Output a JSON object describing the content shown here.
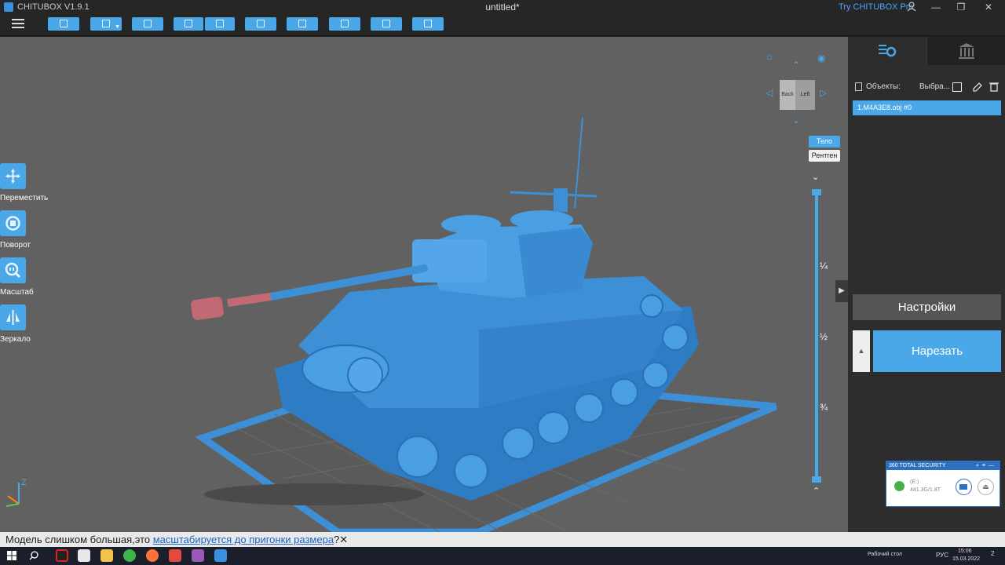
{
  "titlebar": {
    "app_title": "CHITUBOX V1.9.1",
    "document_title": "untitled*",
    "promo_link": "Try CHITUBOX Pro",
    "minimize": "—",
    "maximize": "❐",
    "close": "✕"
  },
  "toolbar": {
    "buttons": [
      "open-file",
      "save",
      "screenshot",
      "import",
      "export",
      "project",
      "support",
      "hollow",
      "pixel",
      "package"
    ]
  },
  "tools": [
    {
      "label": "Переместить",
      "icon": "move-icon"
    },
    {
      "label": "Поворот",
      "icon": "rotate-icon"
    },
    {
      "label": "Масштаб",
      "icon": "scale-icon"
    },
    {
      "label": "Зеркало",
      "icon": "mirror-icon"
    }
  ],
  "navcube": {
    "face_back": "Back",
    "face_left": "Left"
  },
  "view_modes": {
    "body": "Тело",
    "xray": "Рентген"
  },
  "slider": {
    "top_chevron": "⌄",
    "bottom_chevron": "⌃",
    "marks": [
      "¼",
      "½",
      "¾"
    ]
  },
  "panel": {
    "objects_label": "Объекты:",
    "select_label": "Выбра...",
    "object_row": "1.M4A3E8.obj #0",
    "settings_button": "Настройки",
    "slice_button": "Нарезать",
    "collapse_glyph": "▶",
    "up_glyph": "▲"
  },
  "security_popup": {
    "title": "360 TOTAL SECURITY",
    "drive_name": "(E:)",
    "drive_usage": "441.3G/1.8T",
    "eject_glyph": "⏏"
  },
  "status": {
    "message_prefix": "Модель слишком большая,это ",
    "link_text": "масштабируется до пригонки размера",
    "suffix": "?",
    "close_glyph": "✕"
  },
  "taskbar": {
    "desktop_label": "Рабочий стол",
    "language": "РУС",
    "time": "15:06",
    "date": "15.03.2022",
    "notification_count": "2"
  },
  "colors": {
    "accent": "#4aa8e8",
    "viewport_bg": "#616161",
    "model": "#3d8fd6"
  }
}
